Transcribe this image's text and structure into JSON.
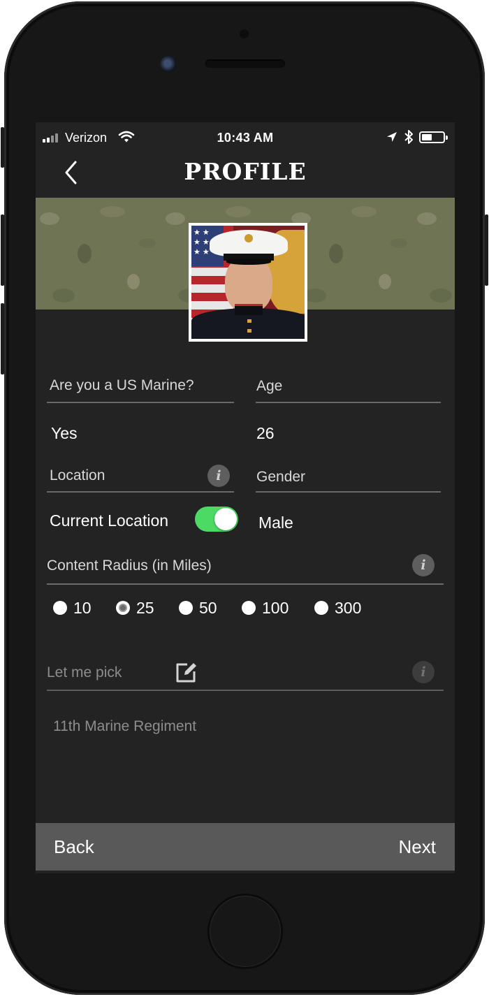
{
  "status_bar": {
    "carrier": "Verizon",
    "time": "10:43 AM",
    "battery_level": 0.4
  },
  "header": {
    "title": "PROFILE",
    "back_icon": "chevron-left-icon"
  },
  "profile": {
    "photo_description": "avatar photo",
    "banner_pattern": "camouflage"
  },
  "form": {
    "marine": {
      "label": "Are you a US Marine?",
      "value": "Yes"
    },
    "age": {
      "label": "Age",
      "value": "26"
    },
    "location": {
      "label": "Location",
      "toggle_label": "Current Location",
      "toggle_on": true,
      "info_icon": "info-icon"
    },
    "gender": {
      "label": "Gender",
      "value": "Male"
    },
    "radius": {
      "label": "Content Radius (in Miles)",
      "options": [
        "10",
        "25",
        "50",
        "100",
        "300"
      ],
      "selected": "25"
    },
    "pick": {
      "label": "Let me pick",
      "edit_icon": "edit-icon",
      "value": "11th Marine Regiment"
    }
  },
  "footer": {
    "back_label": "Back",
    "next_label": "Next"
  },
  "colors": {
    "toggle_on": "#4cd964",
    "screen_bg": "#232323",
    "bar_bg": "#595959"
  }
}
